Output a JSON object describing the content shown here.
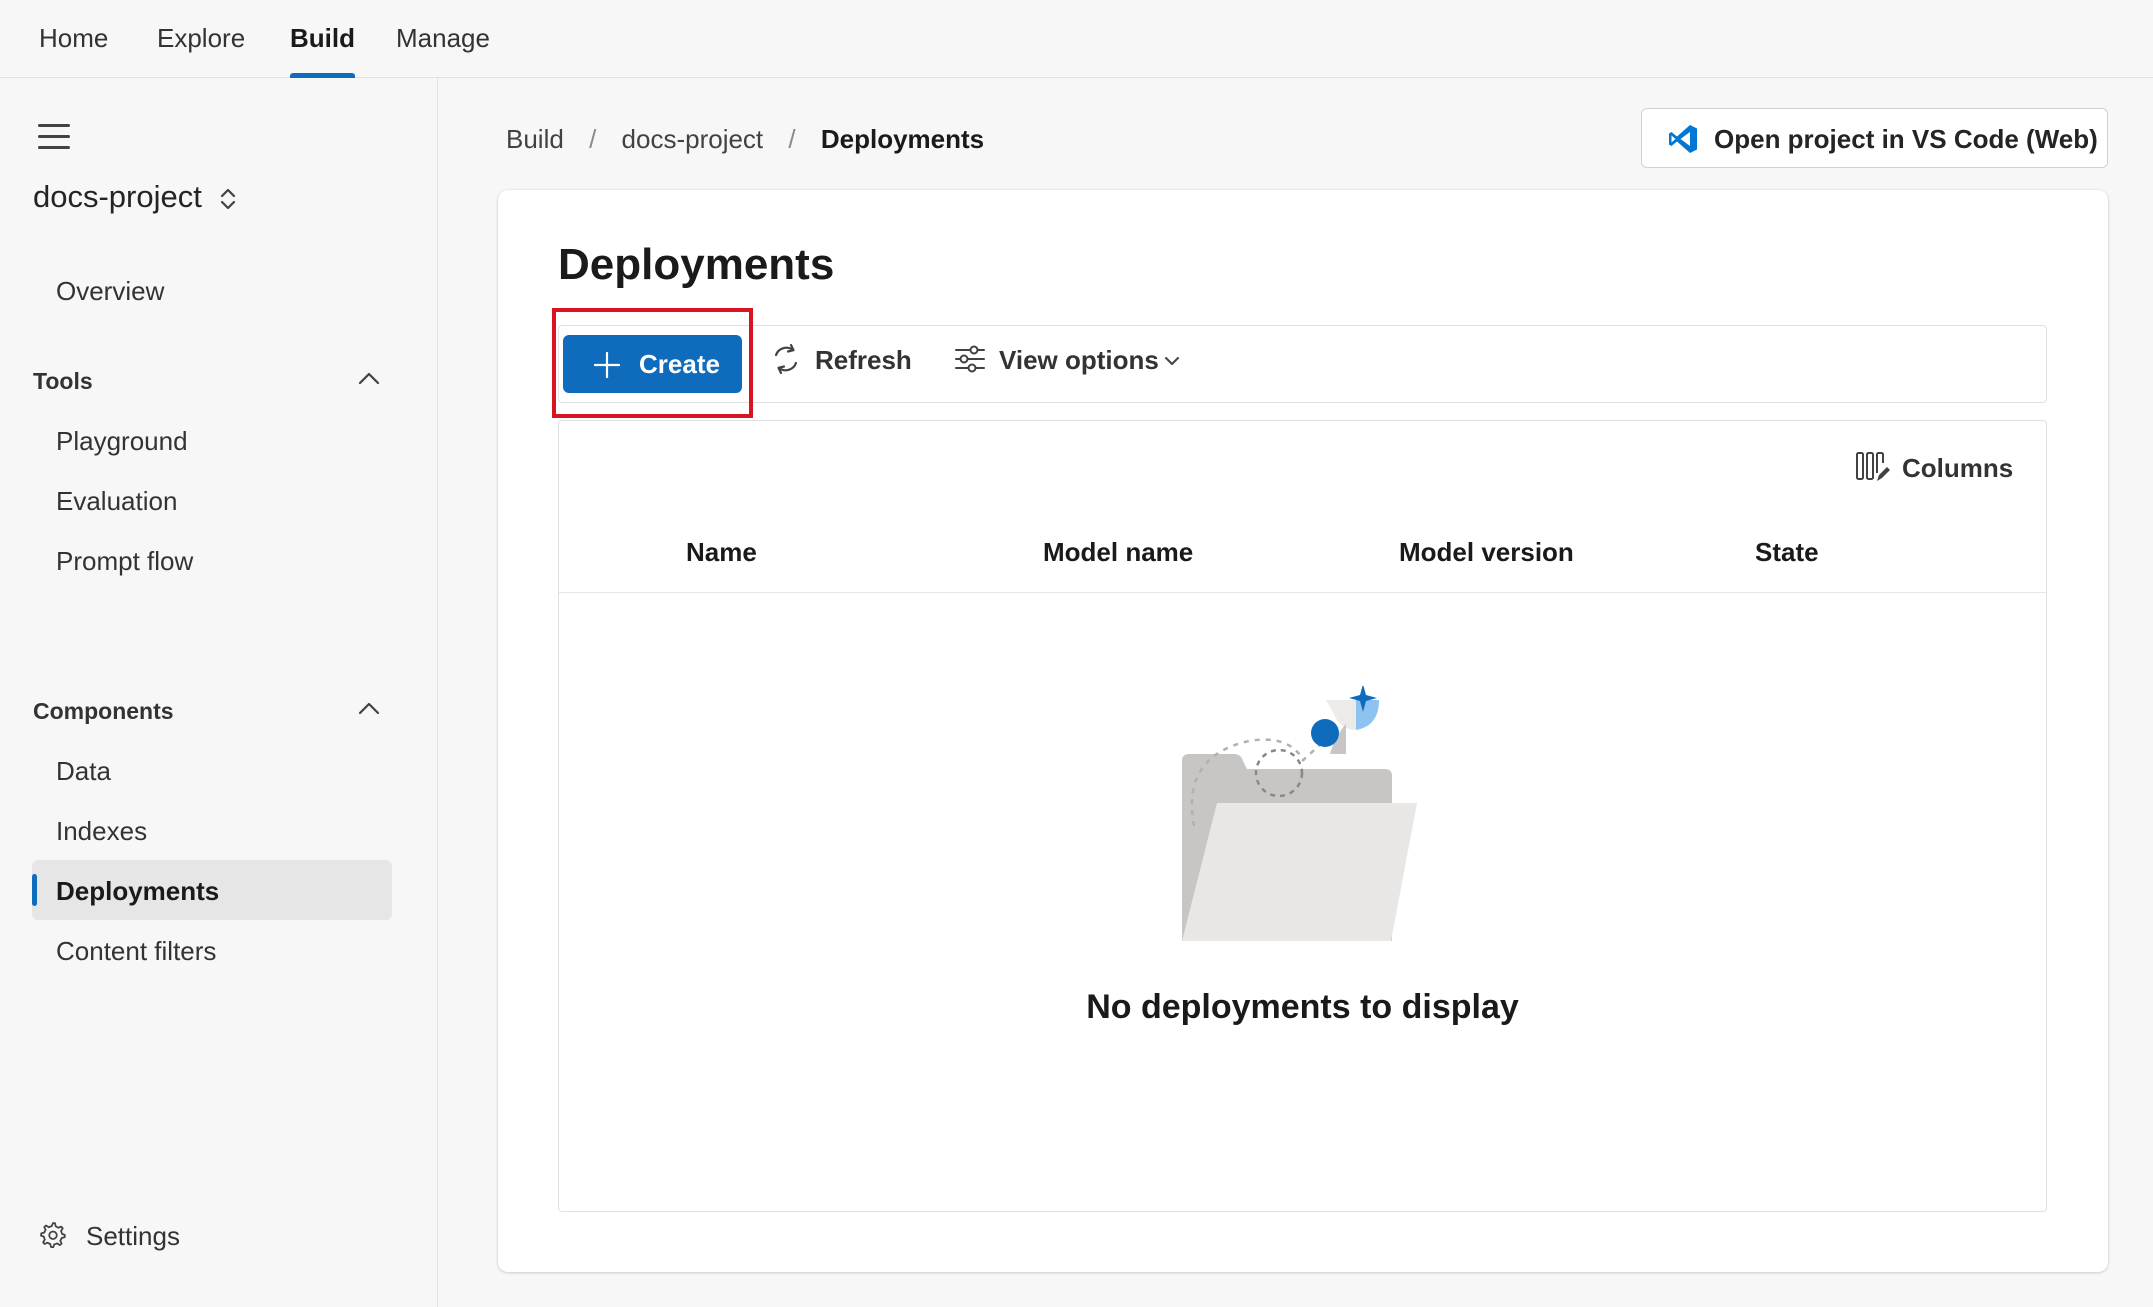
{
  "topnav": {
    "tabs": [
      {
        "label": "Home"
      },
      {
        "label": "Explore"
      },
      {
        "label": "Build"
      },
      {
        "label": "Manage"
      }
    ]
  },
  "sidebar": {
    "project_name": "docs-project",
    "overview": "Overview",
    "tools_group": "Tools",
    "tools_items": [
      "Playground",
      "Evaluation",
      "Prompt flow"
    ],
    "components_group": "Components",
    "components_items": [
      "Data",
      "Indexes",
      "Deployments",
      "Content filters"
    ],
    "selected_item": "Deployments",
    "settings": "Settings"
  },
  "breadcrumb": {
    "items": [
      "Build",
      "docs-project",
      "Deployments"
    ],
    "separator": "/"
  },
  "header": {
    "vscode_button": "Open project in VS Code (Web)"
  },
  "main": {
    "title": "Deployments",
    "toolbar": {
      "create": "Create",
      "refresh": "Refresh",
      "view_options": "View options"
    },
    "table": {
      "columns_button": "Columns",
      "headers": [
        "Name",
        "Model name",
        "Model version",
        "State"
      ],
      "empty_message": "No deployments to display"
    }
  },
  "colors": {
    "accent": "#0f6cbd",
    "highlight": "#d7141f",
    "vscode_blue": "#0078d4"
  }
}
